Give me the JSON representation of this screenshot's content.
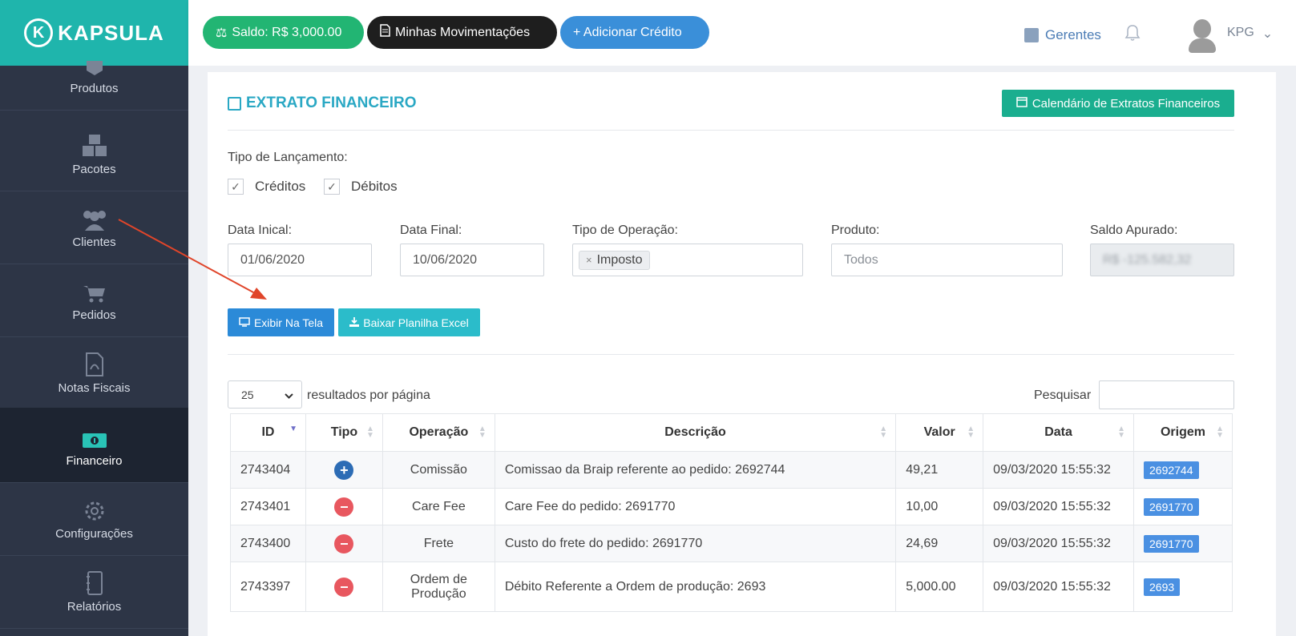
{
  "sidebar": {
    "brand": "KAPSULA",
    "brand_mark": "K",
    "items": [
      {
        "label": "Produtos",
        "icon": "box-icon"
      },
      {
        "label": "Pacotes",
        "icon": "boxes-icon"
      },
      {
        "label": "Clientes",
        "icon": "users-icon"
      },
      {
        "label": "Pedidos",
        "icon": "cart-icon"
      },
      {
        "label": "Notas Fiscais",
        "icon": "pdf-file-icon"
      },
      {
        "label": "Financeiro",
        "icon": "money-icon"
      },
      {
        "label": "Configurações",
        "icon": "gear-icon"
      },
      {
        "label": "Relatórios",
        "icon": "notebook-icon"
      }
    ],
    "active_item": "Financeiro"
  },
  "topbar": {
    "saldo_label": "Saldo: R$ 3,000.00",
    "movimentacoes_label": "Minhas Movimentações",
    "adicionar_label": "+ Adicionar Crédito",
    "gerentes_label": "Gerentes",
    "user_label": "KPG",
    "user_caret": "⌄"
  },
  "page": {
    "title": "EXTRATO FINANCEIRO",
    "calendar_button": "Calendário de Extratos Financeiros",
    "tipo_lancamento_label": "Tipo de Lançamento:",
    "creditos_label": "Créditos",
    "debitos_label": "Débitos",
    "check_mark": "✓",
    "data_inicial_label": "Data Inical:",
    "data_inicial_value": "01/06/2020",
    "data_final_label": "Data Final:",
    "data_final_value": "10/06/2020",
    "tipo_operacao_label": "Tipo de Operação:",
    "tipo_operacao_tag": "Imposto",
    "produto_label": "Produto:",
    "produto_placeholder": "Todos",
    "saldo_apurado_label": "Saldo Apurado:",
    "saldo_apurado_value": "R$ -125.582,32",
    "exibir_button": "Exibir Na Tela",
    "excel_button": "Baixar Planilha Excel",
    "page_length_value": "25",
    "page_length_label": "resultados por página",
    "search_label": "Pesquisar"
  },
  "table": {
    "columns": [
      "ID",
      "Tipo",
      "Operação",
      "Descrição",
      "Valor",
      "Data",
      "Origem"
    ],
    "rows": [
      {
        "id": "2743404",
        "tipo": "credit",
        "tipo_symbol": "+",
        "operacao": "Comissão",
        "descricao": "Comissao da Braip referente ao pedido: 2692744",
        "valor": "49,21",
        "data": "09/03/2020 15:55:32",
        "origem": "2692744"
      },
      {
        "id": "2743401",
        "tipo": "debit",
        "tipo_symbol": "−",
        "operacao": "Care Fee",
        "descricao": "Care Fee do pedido: 2691770",
        "valor": "10,00",
        "data": "09/03/2020 15:55:32",
        "origem": "2691770"
      },
      {
        "id": "2743400",
        "tipo": "debit",
        "tipo_symbol": "−",
        "operacao": "Frete",
        "descricao": "Custo do frete do pedido: 2691770",
        "valor": "24,69",
        "data": "09/03/2020 15:55:32",
        "origem": "2691770"
      },
      {
        "id": "2743397",
        "tipo": "debit",
        "tipo_symbol": "−",
        "operacao": "Ordem de Produção",
        "descricao": "Débito Referente a Ordem de produção: 2693",
        "valor": "5,000.00",
        "data": "09/03/2020 15:55:32",
        "origem": "2693"
      }
    ]
  },
  "colors": {
    "sidebar_bg": "#2d3546",
    "logo_bg": "#1fb5ac",
    "saldo_pill": "#22b573",
    "accent_blue": "#3a8fd9",
    "title_color": "#2aa8c4",
    "credit_icon": "#2c6cb5",
    "debit_icon": "#e8575f",
    "annotation_arrow": "#e0452a"
  }
}
